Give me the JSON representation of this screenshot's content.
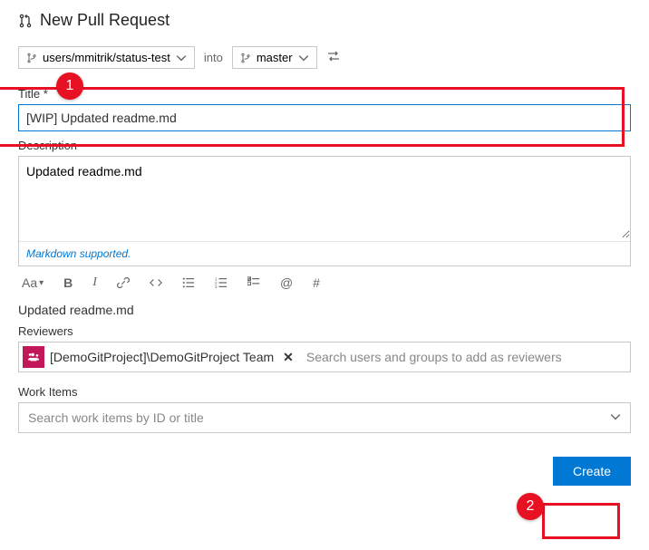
{
  "header": {
    "title": "New Pull Request"
  },
  "branches": {
    "source": "users/mmitrik/status-test",
    "into_label": "into",
    "target": "master"
  },
  "title_field": {
    "label": "Title",
    "required_mark": "*",
    "value": "[WIP] Updated readme.md"
  },
  "description_field": {
    "label": "Description",
    "value": "Updated readme.md",
    "footer_link": "Markdown supported."
  },
  "toolbar": {
    "font_size_label": "Aa",
    "bold": "B",
    "italic": "I",
    "at": "@",
    "hash": "#"
  },
  "preview_text": "Updated readme.md",
  "reviewers": {
    "label": "Reviewers",
    "chip": "[DemoGitProject]\\DemoGitProject Team",
    "placeholder": "Search users and groups to add as reviewers"
  },
  "work_items": {
    "label": "Work Items",
    "placeholder": "Search work items by ID or title"
  },
  "actions": {
    "create": "Create"
  },
  "callouts": {
    "one": "1",
    "two": "2"
  }
}
